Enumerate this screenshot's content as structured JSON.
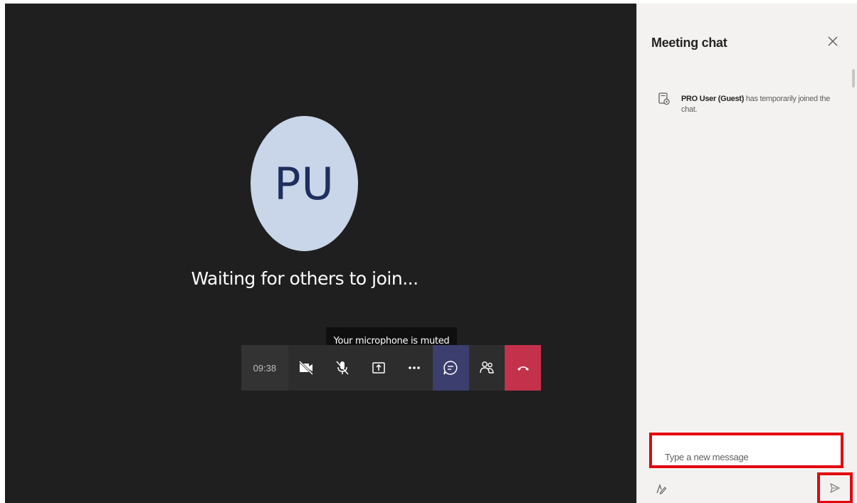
{
  "stage": {
    "avatar_initials": "PU",
    "status_text": "Waiting for others to join...",
    "tooltip": "Your microphone is muted"
  },
  "toolbar": {
    "timer": "09:38",
    "buttons": [
      {
        "name": "camera-off-icon"
      },
      {
        "name": "mic-off-icon"
      },
      {
        "name": "share-tray-icon"
      },
      {
        "name": "more-actions-icon"
      },
      {
        "name": "chat-icon",
        "active": true
      },
      {
        "name": "participants-icon"
      },
      {
        "name": "hang-up-icon"
      }
    ],
    "colors": {
      "bar": "#2d2d2d",
      "active": "#3c3e6e",
      "hangup": "#c4314b"
    }
  },
  "chat": {
    "title": "Meeting chat",
    "system_message": {
      "user": "PRO User (Guest)",
      "text": " has temporarily joined the chat."
    },
    "compose_placeholder": "Type a new message",
    "highlight_color": "#e3060f"
  }
}
